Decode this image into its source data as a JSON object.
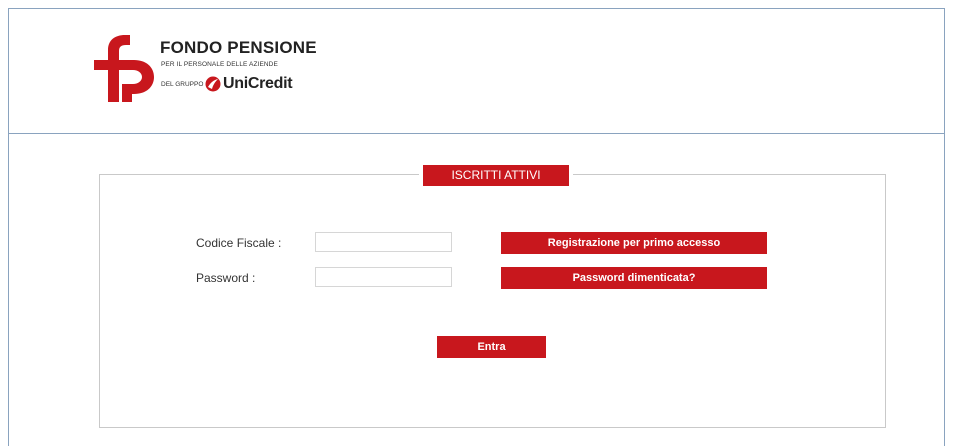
{
  "header": {
    "logo_title": "FONDO PENSIONE",
    "logo_subtitle_line1": "PER IL PERSONALE DELLE AZIENDE",
    "logo_subtitle_line2": "DEL GRUPPO",
    "brand_name": "UniCredit",
    "logo_icon": "fp-logo-icon",
    "brand_icon": "unicredit-logo-icon"
  },
  "panel": {
    "title": "ISCRITTI ATTIVI"
  },
  "form": {
    "codice_fiscale_label": "Codice Fiscale :",
    "codice_fiscale_value": "",
    "password_label": "Password :",
    "password_value": "",
    "register_button": "Registrazione per primo accesso",
    "forgot_button": "Password dimenticata?",
    "submit_button": "Entra"
  },
  "colors": {
    "accent": "#c8171d",
    "border": "#8aa3bf",
    "panel_border": "#c9c9c9"
  }
}
